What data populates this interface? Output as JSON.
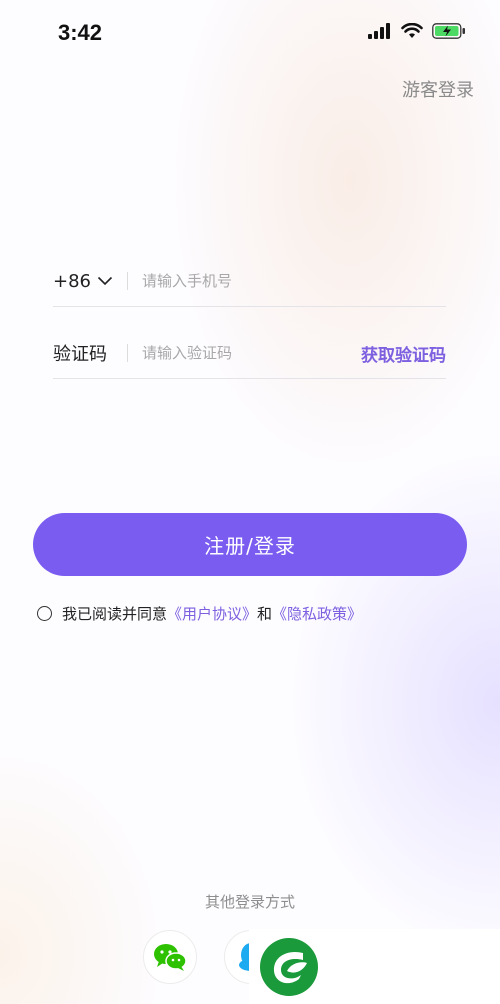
{
  "status_bar": {
    "time": "3:42",
    "icons": [
      "signal-icon",
      "wifi-icon",
      "battery-charging-icon"
    ]
  },
  "header": {
    "guest_login": "游客登录"
  },
  "phone_field": {
    "country_code": "+86",
    "placeholder": "请输入手机号",
    "value": ""
  },
  "code_field": {
    "label": "验证码",
    "placeholder": "请输入验证码",
    "value": "",
    "get_code_label": "获取验证码"
  },
  "login_button": {
    "label": "注册/登录"
  },
  "agreement": {
    "prefix": "我已阅读并同意",
    "user_agreement": "《用户协议》",
    "conjunction": "和",
    "privacy_policy": "《隐私政策》",
    "checked": false
  },
  "other_login": {
    "title": "其他登录方式",
    "methods": [
      "wechat-icon",
      "qq-icon"
    ]
  },
  "colors": {
    "accent": "#7a5cf0",
    "link": "#7d60e0",
    "wechat": "#2dc100",
    "qq": "#1eaaf1",
    "watermark_green": "#1a9a3a"
  }
}
